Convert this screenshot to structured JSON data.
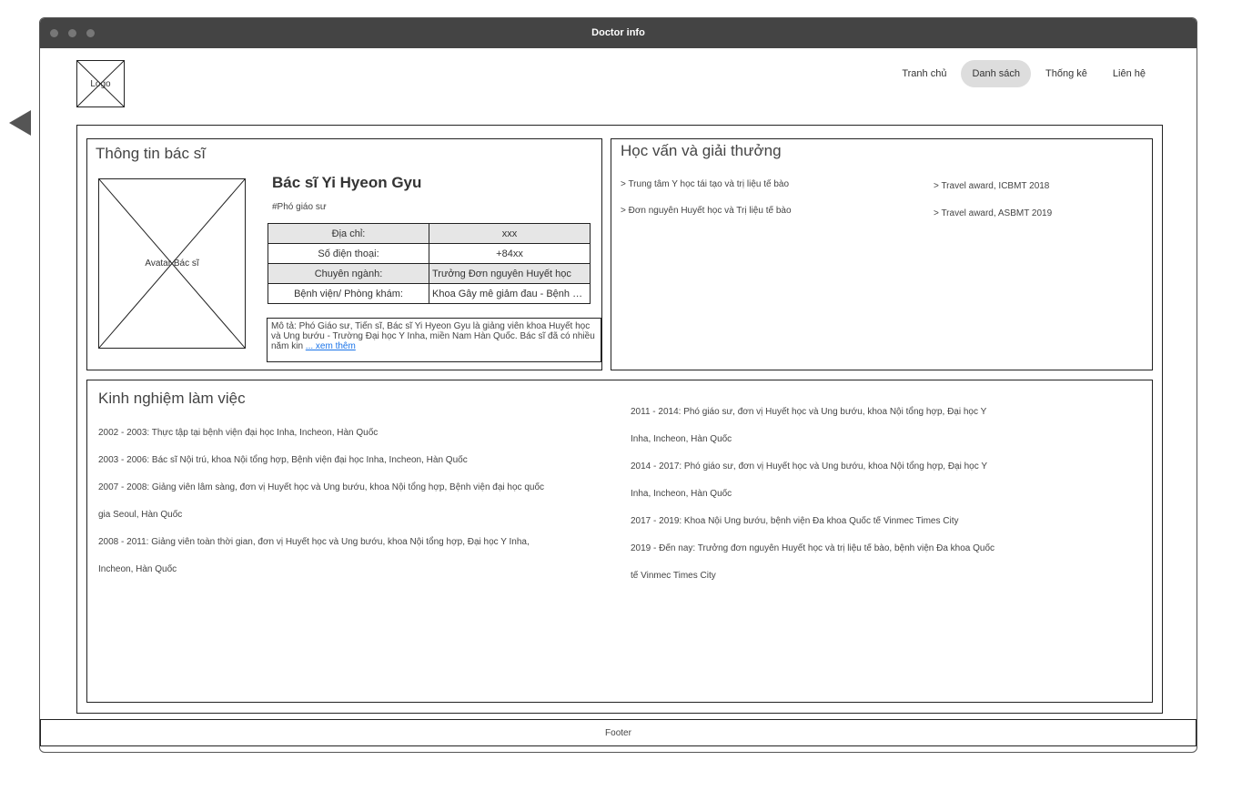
{
  "window": {
    "title": "Doctor info"
  },
  "logo": {
    "label": "Logo"
  },
  "nav": {
    "items": [
      "Tranh chủ",
      "Danh sách",
      "Thống kê",
      "Liên hệ"
    ],
    "active_item": "Danh sách"
  },
  "doctor_info": {
    "title": "Thông tin bác sĩ",
    "avatar_label": "Avatar Bác sĩ",
    "name": "Bác sĩ Yi Hyeon Gyu",
    "position": "#Phó giáo sư",
    "fields": [
      {
        "label": "Địa chỉ:",
        "value": "xxx"
      },
      {
        "label": "Số điện thoại:",
        "value": "+84xx"
      },
      {
        "label": "Chuyên ngành:",
        "value": "Trưởng Đơn nguyên Huyết học"
      },
      {
        "label": "Bệnh viện/ Phòng khám:",
        "value": "Khoa Gây mê giảm đau - Bệnh viện"
      }
    ],
    "description": "Mô tả: Phó Giáo sư, Tiến sĩ, Bác sĩ Yi Hyeon Gyu là giảng viên khoa Huyết học và Ung bướu - Trường Đại học Y Inha, miền Nam Hàn Quốc. Bác sĩ đã có nhiều năm kin",
    "see_more": "... xem thêm"
  },
  "education": {
    "title": "Học vấn và giải thưởng",
    "items": [
      "> Trung tâm Y học tái tạo và trị liệu tế bào",
      "> Đơn nguyên Huyết học và Trị liệu tế bào"
    ],
    "awards": [
      "> Travel award, ICBMT 2018",
      "> Travel award, ASBMT 2019"
    ]
  },
  "experience": {
    "title": "Kinh nghiệm làm việc",
    "left_lines": [
      "2002 - 2003: Thực tập tại bệnh viện đại học Inha, Incheon, Hàn Quốc",
      "2003 - 2006: Bác sĩ Nội trú, khoa Nội tổng hợp, Bệnh viện đại học Inha, Incheon, Hàn Quốc",
      "2007 - 2008: Giảng viên lâm sàng, đơn vị Huyết học và Ung bướu, khoa Nội tổng hợp, Bệnh viện đại học quốc",
      "gia Seoul, Hàn Quốc",
      "2008 - 2011: Giảng viên toàn thời gian, đơn vị Huyết học và Ung bướu, khoa Nội tổng hợp, Đại học Y Inha,",
      "Incheon, Hàn Quốc"
    ],
    "right_lines": [
      "2011 - 2014: Phó giáo sư, đơn vị Huyết học và Ung bướu, khoa Nội tổng hợp, Đại học Y",
      "Inha, Incheon, Hàn Quốc",
      "2014 - 2017: Phó giáo sư, đơn vị Huyết học và Ung bướu, khoa Nội tổng hợp, Đại học Y",
      "Inha, Incheon, Hàn Quốc",
      "2017 - 2019: Khoa Nội Ung bướu, bệnh viện Đa khoa Quốc tế Vinmec Times City",
      "2019 - Đến nay: Trưởng đơn nguyên Huyết học và trị liệu tế bào, bệnh viện Đa khoa Quốc",
      "tế Vinmec Times City"
    ]
  },
  "footer": {
    "label": "Footer"
  }
}
